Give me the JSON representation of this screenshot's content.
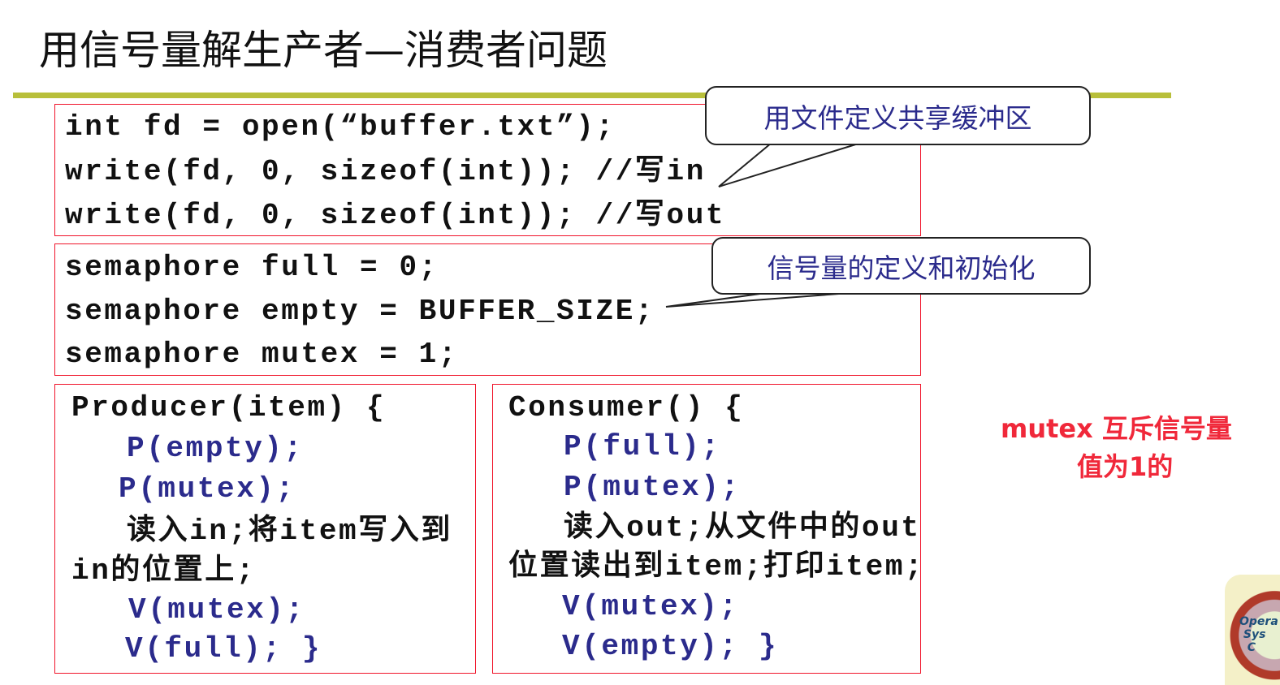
{
  "slide": {
    "title": "用信号量解生产者—消费者问题",
    "file_block": [
      "int fd = open(“buffer.txt”);",
      "write(fd, 0, sizeof(int)); //写in",
      "write(fd, 0, sizeof(int)); //写out"
    ],
    "semaphore_block": [
      "semaphore full = 0;",
      "semaphore empty = BUFFER_SIZE;",
      "semaphore mutex = 1;"
    ],
    "producer": {
      "header": "Producer(item) {",
      "p_empty": "P(empty);",
      "p_mutex": "P(mutex);",
      "body1": "读入in;将item写入到",
      "body2": "in的位置上;",
      "v_mutex": "V(mutex);",
      "v_full": "V(full); }"
    },
    "consumer": {
      "header": "Consumer() {",
      "p_full": "P(full);",
      "p_mutex": "P(mutex);",
      "body1": "读入out;从文件中的out",
      "body2": "位置读出到item;打印item;",
      "v_mutex": "V(mutex);",
      "v_empty": "V(empty); }"
    },
    "callouts": {
      "shared_buffer": "用文件定义共享缓冲区",
      "semaphore_def": "信号量的定义和初始化"
    },
    "note": {
      "line1": "mutex 互斥信号量",
      "line2": "值为1的"
    },
    "logo_text": "Operating Systems Concepts",
    "colors": {
      "accent_rule": "#b8bf3a",
      "box_border": "#f0142a",
      "code_blue": "#2b2b8c",
      "note_red": "#f0283a"
    }
  }
}
